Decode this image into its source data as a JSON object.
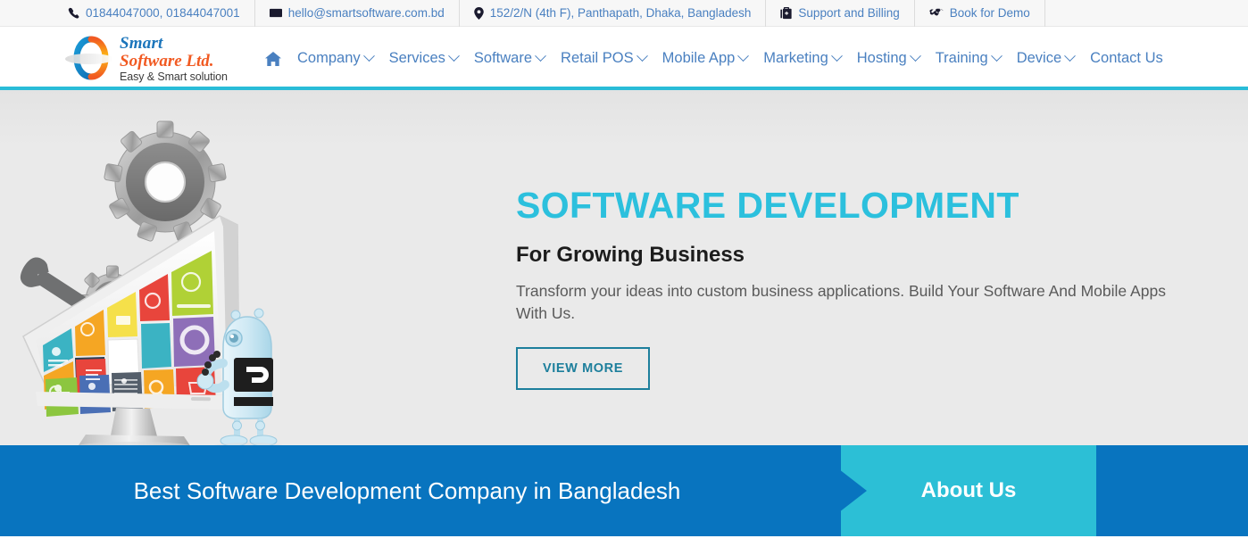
{
  "topbar": {
    "items": [
      {
        "icon": "phone-icon",
        "label": "01844047000, 01844047001"
      },
      {
        "icon": "envelope-icon",
        "label": "hello@smartsoftware.com.bd"
      },
      {
        "icon": "map-pin-icon",
        "label": "152/2/N (4th F), Panthapath, Dhaka, Bangladesh"
      },
      {
        "icon": "briefcase-medical-icon",
        "label": "Support and Billing"
      },
      {
        "icon": "handshake-icon",
        "label": "Book for Demo"
      }
    ]
  },
  "logo": {
    "line1": "Smart",
    "line2": "Software Ltd.",
    "tagline": "Easy & Smart solution"
  },
  "nav": {
    "home_icon": "home-icon",
    "items": [
      {
        "label": "Company",
        "has_dropdown": true
      },
      {
        "label": "Services",
        "has_dropdown": true
      },
      {
        "label": "Software",
        "has_dropdown": true
      },
      {
        "label": "Retail POS",
        "has_dropdown": true
      },
      {
        "label": "Mobile App",
        "has_dropdown": true
      },
      {
        "label": "Marketing",
        "has_dropdown": true
      },
      {
        "label": "Hosting",
        "has_dropdown": true
      },
      {
        "label": "Training",
        "has_dropdown": true
      },
      {
        "label": "Device",
        "has_dropdown": true
      },
      {
        "label": "Contact Us",
        "has_dropdown": false
      }
    ]
  },
  "hero": {
    "title": "SOFTWARE DEVELOPMENT",
    "subtitle": "For Growing Business",
    "description": "Transform your ideas into custom business applications. Build Your Software And Mobile Apps With Us.",
    "cta_label": "VIEW MORE",
    "slides": 3,
    "active_slide": 1,
    "artwork": "monitor-gears-robot-illustration"
  },
  "banner": {
    "headline": "Best Software Development Company in Bangladesh",
    "about_label": "About Us"
  },
  "colors": {
    "accent_cyan": "#2cc0dd",
    "banner_blue": "#0874bf",
    "about_teal": "#2cbfd6",
    "link_blue": "#4a80c0",
    "cta_border": "#1d7f9c",
    "hero_bg": "#eaeaea",
    "topbar_bg": "#f7f7f7"
  }
}
